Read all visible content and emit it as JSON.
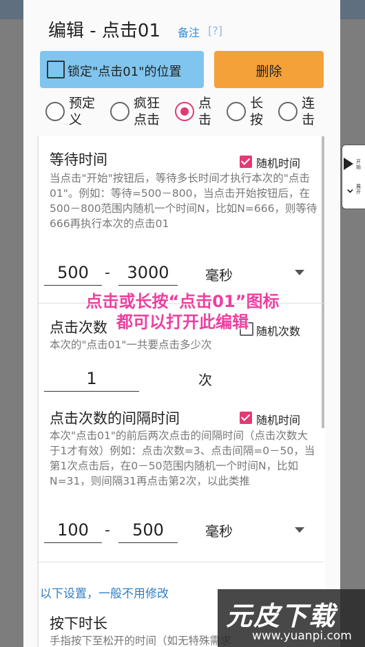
{
  "dialog": {
    "title": "编辑 - 点击01",
    "remark_link": "备注",
    "help_link": "[?]",
    "lock_label": "锁定\"点击01\"的位置",
    "delete_label": "删除"
  },
  "modes": [
    {
      "label": "预定义",
      "selected": false
    },
    {
      "label": "疯狂点击",
      "selected": false
    },
    {
      "label": "点击",
      "selected": true
    },
    {
      "label": "长按",
      "selected": false
    },
    {
      "label": "连击",
      "selected": false
    }
  ],
  "wait": {
    "title": "等待时间",
    "random_label": "随机时间",
    "random_checked": true,
    "desc": "当点击\"开始\"按钮后，等待多长时间才执行本次的\"点击01\"。例如：等待=500－800，当点击开始按钮后，在500－800范围内随机一个时间N，比如N=666，则等待666再执行本次的点击01",
    "min": "500",
    "dash": "-",
    "max": "3000",
    "unit": "毫秒"
  },
  "count": {
    "title": "点击次数",
    "random_label": "随机次数",
    "random_checked": false,
    "desc": "本次的\"点击01\"一共要点击多少次",
    "value": "1",
    "unit": "次"
  },
  "interval": {
    "title": "点击次数的间隔时间",
    "random_label": "随机时间",
    "random_checked": true,
    "desc": "本次\"点击01\"的前后两次点击的间隔时间（点击次数大于1才有效）例如：点击次数=3、点击间隔=0－50，当第1次点击后，在0－50范围内随机一个时间N，比如N=31，则间隔31再点击第2次，以此类推",
    "min": "100",
    "dash": "-",
    "max": "500",
    "unit": "毫秒"
  },
  "overlay": {
    "line1": "点击或长按“点击01”图标",
    "line2": "都可以打开此编辑"
  },
  "advanced_notice": "以下设置，一般不用修改",
  "press": {
    "title": "按下时长",
    "desc": "手指按下至松开的时间（如无特殊需求"
  },
  "side_panel": {
    "start_label": "开始",
    "expand_label": "展开"
  },
  "watermark": {
    "logo": "元皮下载",
    "url": "www.yuanpi.com"
  },
  "colors": {
    "accent": "#e23a73",
    "lock_button": "#7fc5ef",
    "delete_button": "#f5a13a",
    "overlay_text": "#ef3fa0",
    "link": "#2f8fd6"
  }
}
